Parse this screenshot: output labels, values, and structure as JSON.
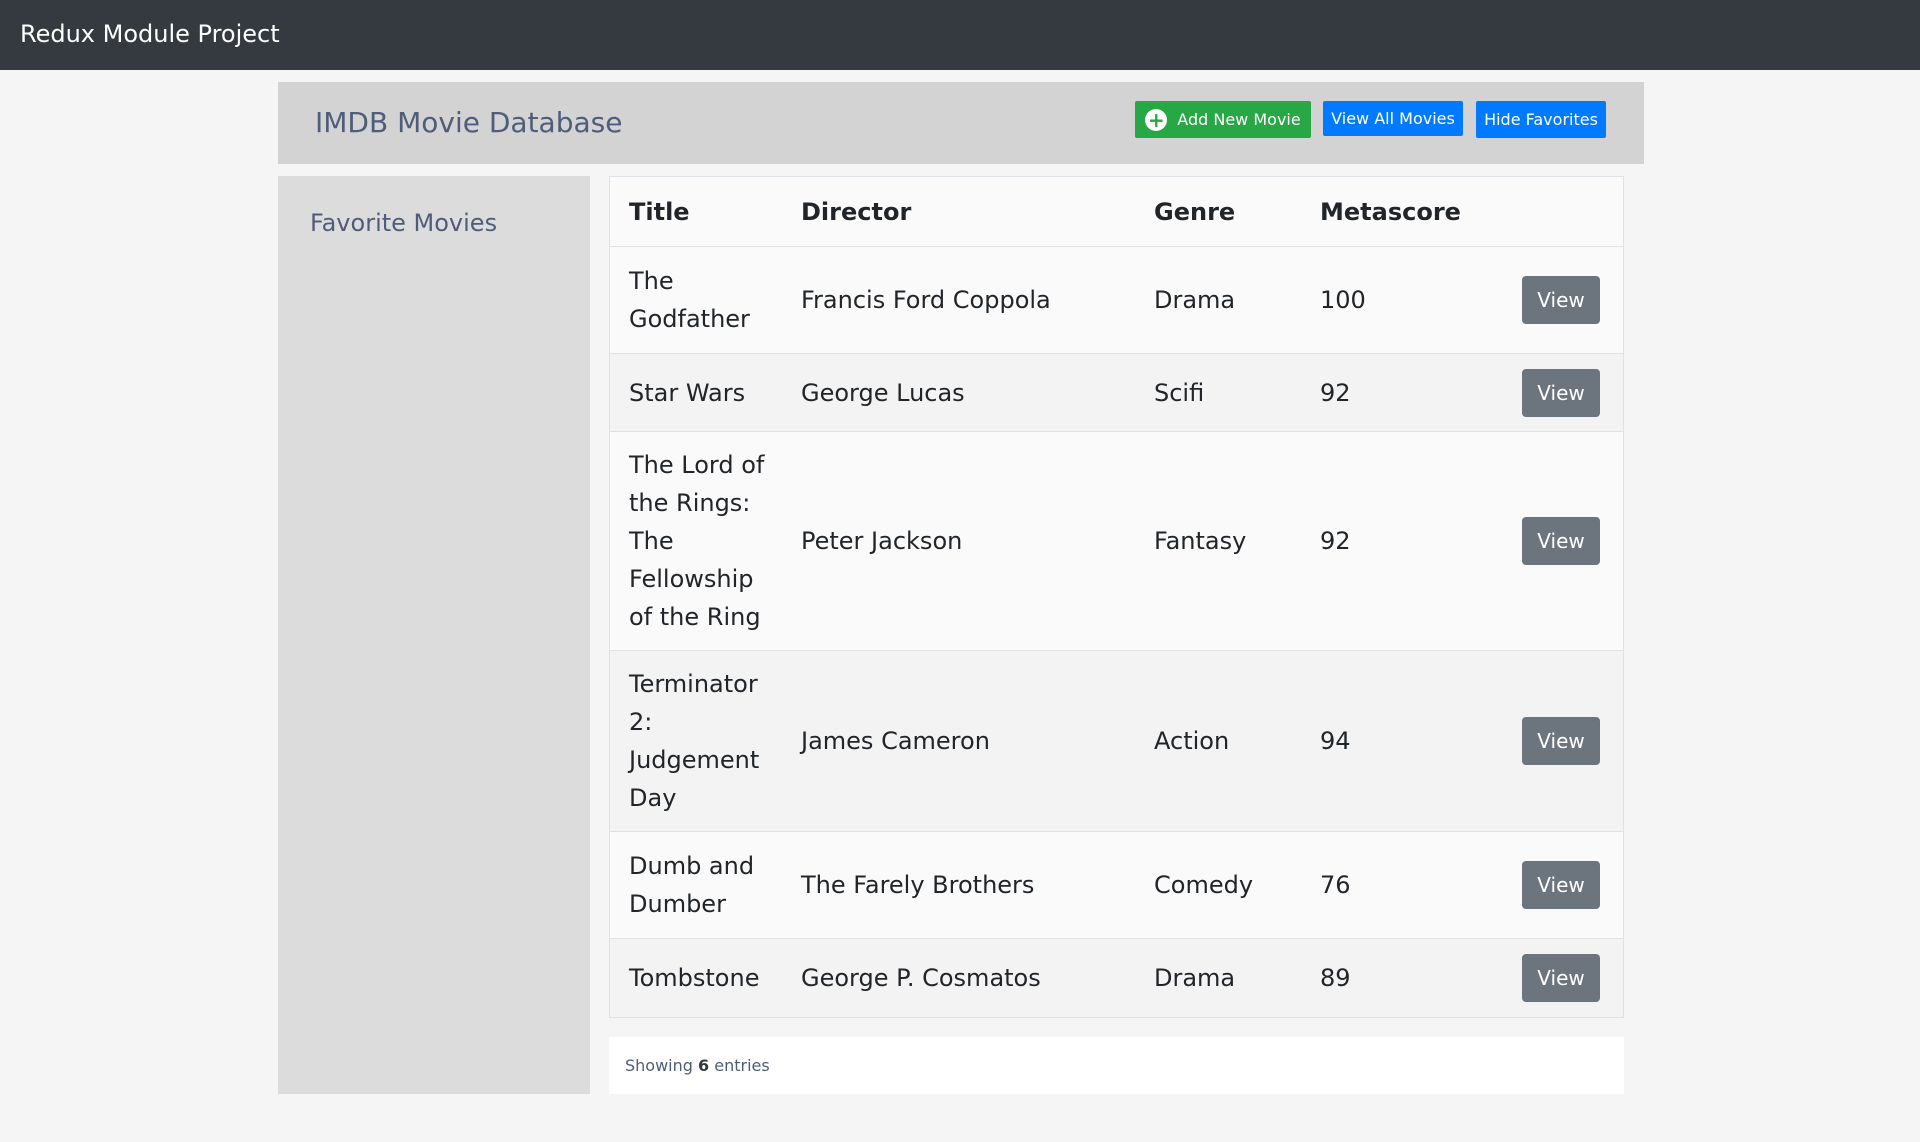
{
  "navbar": {
    "brand": "Redux Module Project"
  },
  "header": {
    "title": "IMDB Movie Database",
    "add_button": "Add New Movie",
    "view_all_button": "View All Movies",
    "hide_favorites_button": "Hide Favorites"
  },
  "sidebar": {
    "title": "Favorite Movies"
  },
  "table": {
    "columns": [
      "Title",
      "Director",
      "Genre",
      "Metascore"
    ],
    "view_label": "View",
    "rows": [
      {
        "title": "The Godfather",
        "director": "Francis Ford Coppola",
        "genre": "Drama",
        "metascore": "100"
      },
      {
        "title": "Star Wars",
        "director": "George Lucas",
        "genre": "Scifi",
        "metascore": "92"
      },
      {
        "title": "The Lord of the Rings: The Fellowship of the Ring",
        "director": "Peter Jackson",
        "genre": "Fantasy",
        "metascore": "92"
      },
      {
        "title": "Terminator 2: Judgement Day",
        "director": "James Cameron",
        "genre": "Action",
        "metascore": "94"
      },
      {
        "title": "Dumb and Dumber",
        "director": "The Farely Brothers",
        "genre": "Comedy",
        "metascore": "76"
      },
      {
        "title": "Tombstone",
        "director": "George P. Cosmatos",
        "genre": "Drama",
        "metascore": "89"
      }
    ]
  },
  "footer": {
    "showing_prefix": "Showing",
    "count": "6",
    "showing_suffix": "entries"
  }
}
